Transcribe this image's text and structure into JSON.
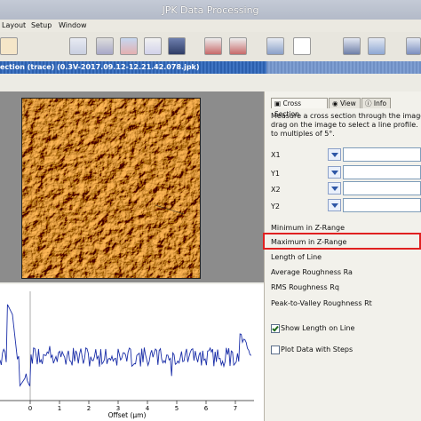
{
  "window": {
    "title": "JPK Data Processing"
  },
  "menu": {
    "items": [
      "Layout",
      "Setup",
      "Window"
    ]
  },
  "document": {
    "title": "ection (trace) (0.3V-2017.09.12-12.21.42.078.jpk)"
  },
  "tabs": [
    {
      "label": "Cross Section",
      "icon": "cross-section-icon",
      "active": true
    },
    {
      "label": "View",
      "icon": "eye-icon",
      "active": false
    },
    {
      "label": "Info",
      "icon": "info-icon",
      "active": false
    }
  ],
  "panel": {
    "description": [
      "Measure a cross section through the image.",
      "drag on the image to select a line profile. Hold",
      "to multiples of 5°."
    ],
    "fields": [
      {
        "label": "X1",
        "value": ""
      },
      {
        "label": "Y1",
        "value": ""
      },
      {
        "label": "X2",
        "value": ""
      },
      {
        "label": "Y2",
        "value": ""
      }
    ],
    "stats": [
      "Minimum in Z-Range",
      "Maximum in Z-Range",
      "Length of Line",
      "Average Roughness Ra",
      "RMS Roughness Rq",
      "Peak-to-Valley Roughness Rt"
    ],
    "highlighted_stat": "Maximum in Z-Range",
    "checkboxes": [
      {
        "label": "Show Length on Line",
        "checked": true
      },
      {
        "label": "Plot Data with Steps",
        "checked": false
      }
    ]
  },
  "plot": {
    "xlabel": "Offset (µm)",
    "xticks": [
      "0",
      "1",
      "2",
      "3",
      "4",
      "5",
      "6",
      "7"
    ],
    "line_color": "#1a2ea8"
  },
  "colors": {
    "highlight": "#e02020",
    "titlebar": "#b8bfcc",
    "doc_tab": "#2b5fad"
  }
}
